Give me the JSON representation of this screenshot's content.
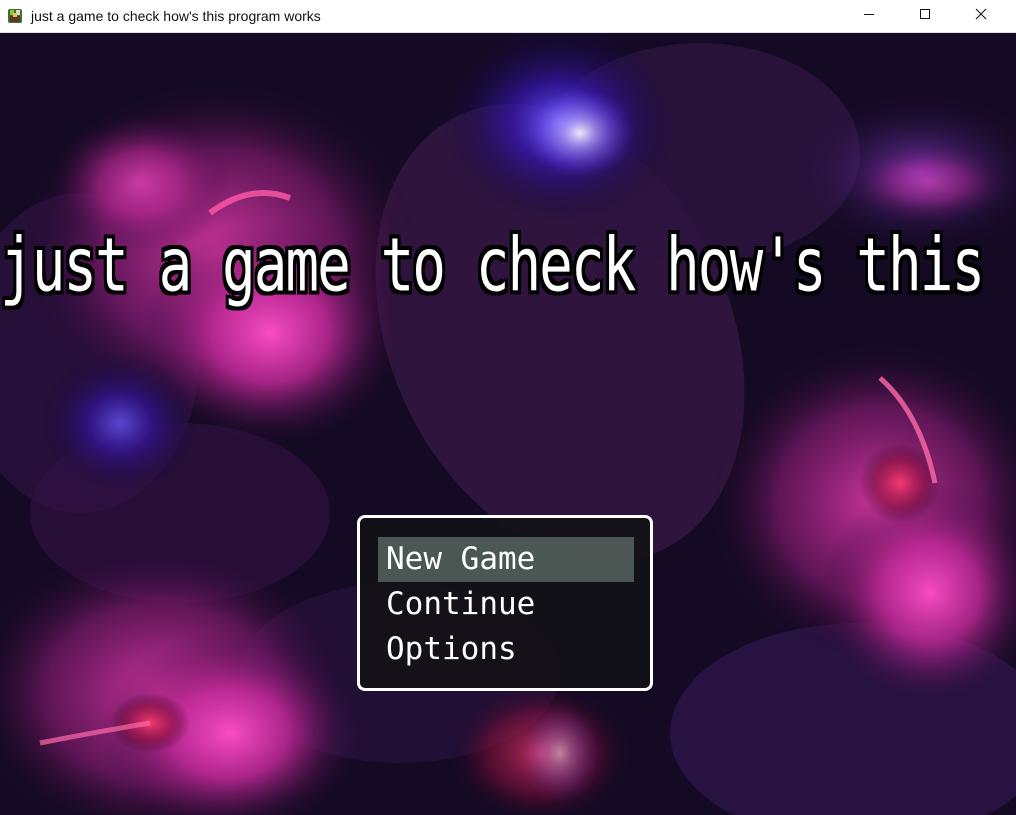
{
  "window": {
    "title": "just a game to check how's this program works",
    "icon": "rpg-maker-icon",
    "controls": [
      "minimize-icon",
      "maximize-icon",
      "close-icon"
    ]
  },
  "game": {
    "title": "just a game to check how's this program works",
    "background": "purple-pink-flowers",
    "menu": {
      "items": [
        {
          "label": "New Game",
          "selected": true
        },
        {
          "label": "Continue",
          "selected": false
        },
        {
          "label": "Options",
          "selected": false
        }
      ]
    }
  },
  "colors": {
    "menu_border": "#ffffff",
    "menu_background": "#121216",
    "selection_highlight": "#6e8278",
    "close_hover": "#e81123"
  }
}
